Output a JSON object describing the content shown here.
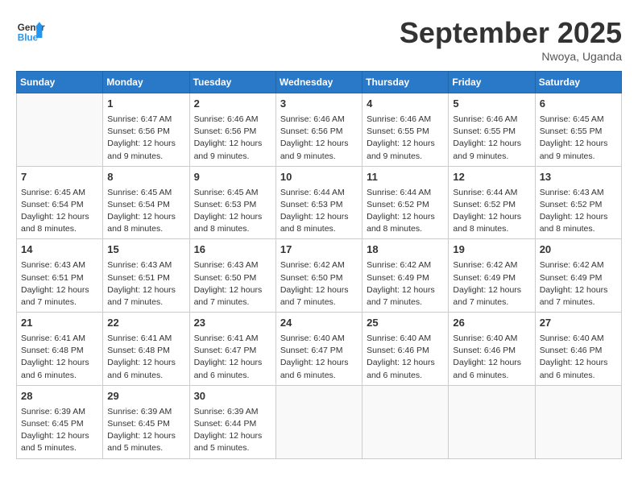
{
  "header": {
    "logo_line1": "General",
    "logo_line2": "Blue",
    "month": "September 2025",
    "location": "Nwoya, Uganda"
  },
  "weekdays": [
    "Sunday",
    "Monday",
    "Tuesday",
    "Wednesday",
    "Thursday",
    "Friday",
    "Saturday"
  ],
  "weeks": [
    [
      {
        "day": "",
        "info": ""
      },
      {
        "day": "1",
        "info": "Sunrise: 6:47 AM\nSunset: 6:56 PM\nDaylight: 12 hours\nand 9 minutes."
      },
      {
        "day": "2",
        "info": "Sunrise: 6:46 AM\nSunset: 6:56 PM\nDaylight: 12 hours\nand 9 minutes."
      },
      {
        "day": "3",
        "info": "Sunrise: 6:46 AM\nSunset: 6:56 PM\nDaylight: 12 hours\nand 9 minutes."
      },
      {
        "day": "4",
        "info": "Sunrise: 6:46 AM\nSunset: 6:55 PM\nDaylight: 12 hours\nand 9 minutes."
      },
      {
        "day": "5",
        "info": "Sunrise: 6:46 AM\nSunset: 6:55 PM\nDaylight: 12 hours\nand 9 minutes."
      },
      {
        "day": "6",
        "info": "Sunrise: 6:45 AM\nSunset: 6:55 PM\nDaylight: 12 hours\nand 9 minutes."
      }
    ],
    [
      {
        "day": "7",
        "info": "Sunrise: 6:45 AM\nSunset: 6:54 PM\nDaylight: 12 hours\nand 8 minutes."
      },
      {
        "day": "8",
        "info": "Sunrise: 6:45 AM\nSunset: 6:54 PM\nDaylight: 12 hours\nand 8 minutes."
      },
      {
        "day": "9",
        "info": "Sunrise: 6:45 AM\nSunset: 6:53 PM\nDaylight: 12 hours\nand 8 minutes."
      },
      {
        "day": "10",
        "info": "Sunrise: 6:44 AM\nSunset: 6:53 PM\nDaylight: 12 hours\nand 8 minutes."
      },
      {
        "day": "11",
        "info": "Sunrise: 6:44 AM\nSunset: 6:52 PM\nDaylight: 12 hours\nand 8 minutes."
      },
      {
        "day": "12",
        "info": "Sunrise: 6:44 AM\nSunset: 6:52 PM\nDaylight: 12 hours\nand 8 minutes."
      },
      {
        "day": "13",
        "info": "Sunrise: 6:43 AM\nSunset: 6:52 PM\nDaylight: 12 hours\nand 8 minutes."
      }
    ],
    [
      {
        "day": "14",
        "info": "Sunrise: 6:43 AM\nSunset: 6:51 PM\nDaylight: 12 hours\nand 7 minutes."
      },
      {
        "day": "15",
        "info": "Sunrise: 6:43 AM\nSunset: 6:51 PM\nDaylight: 12 hours\nand 7 minutes."
      },
      {
        "day": "16",
        "info": "Sunrise: 6:43 AM\nSunset: 6:50 PM\nDaylight: 12 hours\nand 7 minutes."
      },
      {
        "day": "17",
        "info": "Sunrise: 6:42 AM\nSunset: 6:50 PM\nDaylight: 12 hours\nand 7 minutes."
      },
      {
        "day": "18",
        "info": "Sunrise: 6:42 AM\nSunset: 6:49 PM\nDaylight: 12 hours\nand 7 minutes."
      },
      {
        "day": "19",
        "info": "Sunrise: 6:42 AM\nSunset: 6:49 PM\nDaylight: 12 hours\nand 7 minutes."
      },
      {
        "day": "20",
        "info": "Sunrise: 6:42 AM\nSunset: 6:49 PM\nDaylight: 12 hours\nand 7 minutes."
      }
    ],
    [
      {
        "day": "21",
        "info": "Sunrise: 6:41 AM\nSunset: 6:48 PM\nDaylight: 12 hours\nand 6 minutes."
      },
      {
        "day": "22",
        "info": "Sunrise: 6:41 AM\nSunset: 6:48 PM\nDaylight: 12 hours\nand 6 minutes."
      },
      {
        "day": "23",
        "info": "Sunrise: 6:41 AM\nSunset: 6:47 PM\nDaylight: 12 hours\nand 6 minutes."
      },
      {
        "day": "24",
        "info": "Sunrise: 6:40 AM\nSunset: 6:47 PM\nDaylight: 12 hours\nand 6 minutes."
      },
      {
        "day": "25",
        "info": "Sunrise: 6:40 AM\nSunset: 6:46 PM\nDaylight: 12 hours\nand 6 minutes."
      },
      {
        "day": "26",
        "info": "Sunrise: 6:40 AM\nSunset: 6:46 PM\nDaylight: 12 hours\nand 6 minutes."
      },
      {
        "day": "27",
        "info": "Sunrise: 6:40 AM\nSunset: 6:46 PM\nDaylight: 12 hours\nand 6 minutes."
      }
    ],
    [
      {
        "day": "28",
        "info": "Sunrise: 6:39 AM\nSunset: 6:45 PM\nDaylight: 12 hours\nand 5 minutes."
      },
      {
        "day": "29",
        "info": "Sunrise: 6:39 AM\nSunset: 6:45 PM\nDaylight: 12 hours\nand 5 minutes."
      },
      {
        "day": "30",
        "info": "Sunrise: 6:39 AM\nSunset: 6:44 PM\nDaylight: 12 hours\nand 5 minutes."
      },
      {
        "day": "",
        "info": ""
      },
      {
        "day": "",
        "info": ""
      },
      {
        "day": "",
        "info": ""
      },
      {
        "day": "",
        "info": ""
      }
    ]
  ]
}
